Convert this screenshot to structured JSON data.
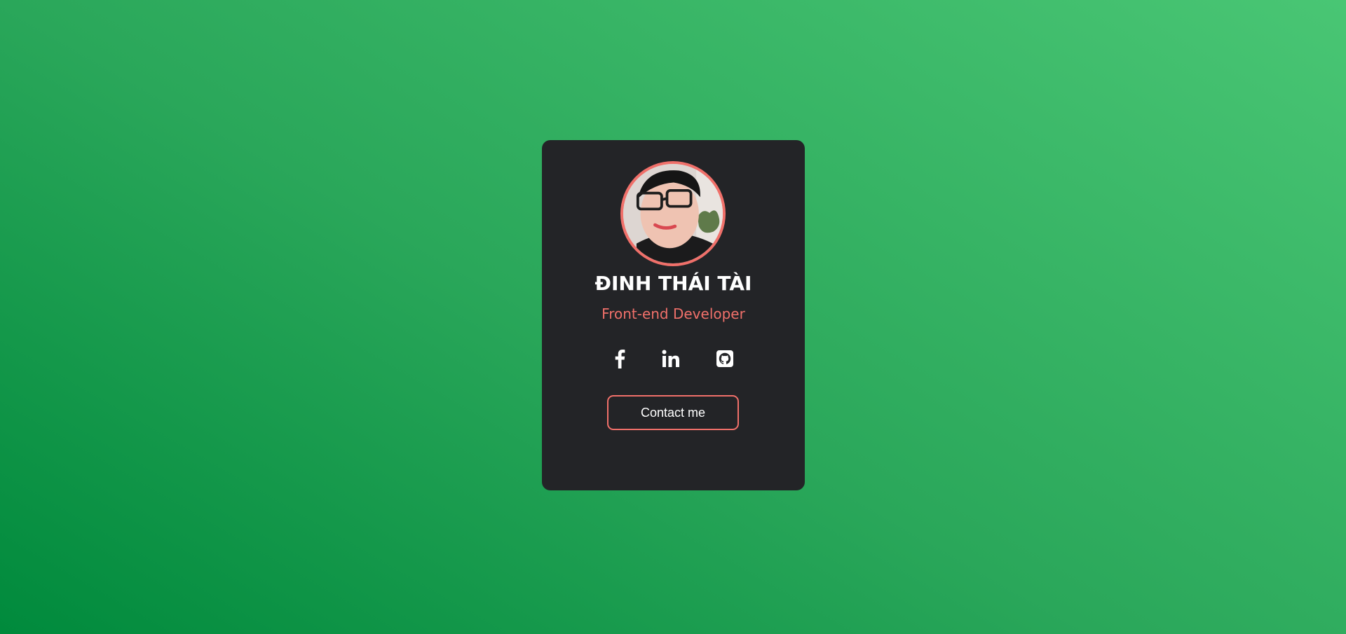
{
  "profile": {
    "name": "ĐINH THÁI TÀI",
    "role": "Front-end Developer"
  },
  "socials": [
    {
      "network": "Facebook",
      "icon": "facebook-icon"
    },
    {
      "network": "LinkedIn",
      "icon": "linkedin-icon"
    },
    {
      "network": "GitHub",
      "icon": "github-icon"
    }
  ],
  "contact": {
    "label": "Contact me"
  },
  "colors": {
    "accent": "#f0706a",
    "card": "#232427",
    "background_start": "#008a3c",
    "background_end": "#49c674",
    "text": "#ffffff"
  }
}
